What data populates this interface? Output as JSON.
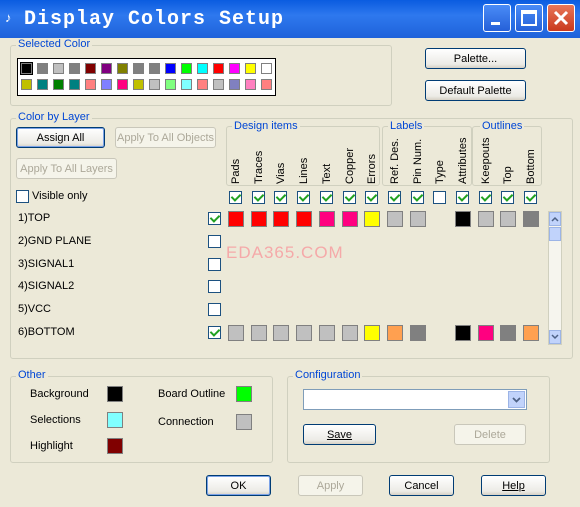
{
  "window": {
    "title": "Display Colors Setup",
    "icon": "music-note-icon"
  },
  "selected_color": {
    "label": "Selected Color",
    "palette_row1": [
      "#000000",
      "#808080",
      "#C0C0C0",
      "#808080",
      "#800000",
      "#800080",
      "#808000",
      "#808080",
      "#808080",
      "#0000FF",
      "#00FF00",
      "#00FFFF",
      "#FF0000",
      "#FF00FF",
      "#FFFF00",
      "#FFFFFF"
    ],
    "palette_row2": [
      "#C0C000",
      "#008080",
      "#008000",
      "#008080",
      "#FF8080",
      "#8080FF",
      "#FF0080",
      "#C0C000",
      "#C0C0C0",
      "#80FF80",
      "#80FFFF",
      "#FF8080",
      "#C0C0C0",
      "#8080C0",
      "#FF80C0",
      "#FF8080"
    ]
  },
  "buttons": {
    "palette": "Palette...",
    "default_palette": "Default Palette",
    "assign_all": "Assign All",
    "apply_all_objects": "Apply To All Objects",
    "apply_all_layers": "Apply To All Layers",
    "save": "Save",
    "delete": "Delete",
    "ok": "OK",
    "apply": "Apply",
    "cancel": "Cancel",
    "help": "Help"
  },
  "color_by_layer": {
    "label": "Color by Layer",
    "visible_only": "Visible only",
    "groups": {
      "design": "Design items",
      "labels": "Labels",
      "outlines": "Outlines"
    },
    "columns": [
      "Pads",
      "Traces",
      "Vias",
      "Lines",
      "Text",
      "Copper",
      "Errors",
      "Ref. Des.",
      "Pin Num.",
      "Type",
      "Attributes",
      "Keepouts",
      "Top",
      "Bottom"
    ],
    "column_checks": [
      true,
      true,
      true,
      true,
      true,
      true,
      true,
      true,
      true,
      false,
      true,
      true,
      true,
      true
    ],
    "layers": [
      {
        "name": "1)TOP",
        "checked": true,
        "colors": [
          "#FF0000",
          "#FF0000",
          "#FF0000",
          "#FF0000",
          "#FF0080",
          "#FF0080",
          "#FFFF00",
          "#C0C0C0",
          "#C0C0C0",
          null,
          "#000000",
          "#C0C0C0",
          "#C0C0C0",
          "#808080"
        ]
      },
      {
        "name": "2)GND PLANE",
        "checked": false,
        "colors": []
      },
      {
        "name": "3)SIGNAL1",
        "checked": false,
        "colors": []
      },
      {
        "name": "4)SIGNAL2",
        "checked": false,
        "colors": []
      },
      {
        "name": "5)VCC",
        "checked": false,
        "colors": []
      },
      {
        "name": "6)BOTTOM",
        "checked": true,
        "colors": [
          "#C0C0C0",
          "#C0C0C0",
          "#C0C0C0",
          "#C0C0C0",
          "#C0C0C0",
          "#C0C0C0",
          "#FFFF00",
          "#FFA050",
          "#808080",
          null,
          "#000000",
          "#FF0080",
          "#808080",
          "#FFA050"
        ]
      }
    ]
  },
  "watermark": "EDA365.COM",
  "other": {
    "label": "Other",
    "items": [
      {
        "label": "Background",
        "color": "#000000"
      },
      {
        "label": "Selections",
        "color": "#80FFFF"
      },
      {
        "label": "Highlight",
        "color": "#800000"
      },
      {
        "label": "Board Outline",
        "color": "#00FF00"
      },
      {
        "label": "Connection",
        "color": "#C0C0C0"
      }
    ]
  },
  "configuration": {
    "label": "Configuration",
    "value": ""
  }
}
